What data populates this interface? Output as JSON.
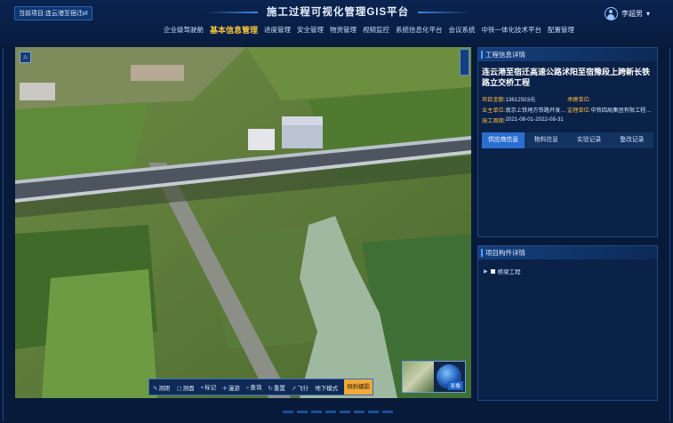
{
  "header": {
    "project_label": "当前项目:",
    "project_value": "连云港至宿迁...",
    "title": "施工过程可视化管理GIS平台",
    "user_name": "李超男"
  },
  "nav": [
    {
      "label": "企业级驾驶舱"
    },
    {
      "label": "基本信息管理",
      "active": true
    },
    {
      "label": "进度管理"
    },
    {
      "label": "安全管理"
    },
    {
      "label": "物资管理"
    },
    {
      "label": "视频监控"
    },
    {
      "label": "系统信息化平台"
    },
    {
      "label": "会议系统"
    },
    {
      "label": "中铁一体化技术平台"
    },
    {
      "label": "配置管理"
    }
  ],
  "map_toolbar": [
    {
      "icon": "measure-icon",
      "glyph": "✎",
      "label": "测距"
    },
    {
      "icon": "area-icon",
      "glyph": "▢",
      "label": "测面"
    },
    {
      "icon": "pin-icon",
      "glyph": "⌖",
      "label": "标记"
    },
    {
      "icon": "roam-icon",
      "glyph": "✈",
      "label": "漫游"
    },
    {
      "icon": "search-icon",
      "glyph": "⌕",
      "label": "查询"
    },
    {
      "icon": "reset-icon",
      "glyph": "↻",
      "label": "重置"
    },
    {
      "icon": "fly-icon",
      "glyph": "➚",
      "label": "飞行"
    },
    {
      "icon": "underground-icon",
      "glyph": "",
      "label": "地下模式"
    },
    {
      "icon": "",
      "glyph": "",
      "label": "倾斜摄影",
      "active": true
    }
  ],
  "minimap": {
    "button": "影像"
  },
  "project_panel": {
    "header": "工程信息详情",
    "project_title": "连云港至宿迁高速公路沭阳至宿豫段上跨新长铁路立交桥工程",
    "fields": [
      {
        "label": "项目金额:",
        "value": "13612503元",
        "label2": "承建单位:",
        "value2": ""
      },
      {
        "label": "业主单位:",
        "value": "南京上铁地方铁路开发有限公司",
        "label2": "监理单位:",
        "value2": "中铁四局集团有限工程监理有..."
      },
      {
        "label": "施工周期:",
        "value": "2021-08-01-2022-08-31",
        "label2": "",
        "value2": ""
      }
    ],
    "tabs": [
      {
        "label": "供应商信息",
        "active": true
      },
      {
        "label": "物料信息"
      },
      {
        "label": "实验记录"
      },
      {
        "label": "整改记录"
      }
    ]
  },
  "component_panel": {
    "header": "项目构件详情",
    "tree": [
      {
        "label": "桥梁工程"
      }
    ]
  },
  "colors": {
    "accent": "#f5c542",
    "tab_active": "#2a6fd0",
    "panel_bg": "#0a2148"
  }
}
